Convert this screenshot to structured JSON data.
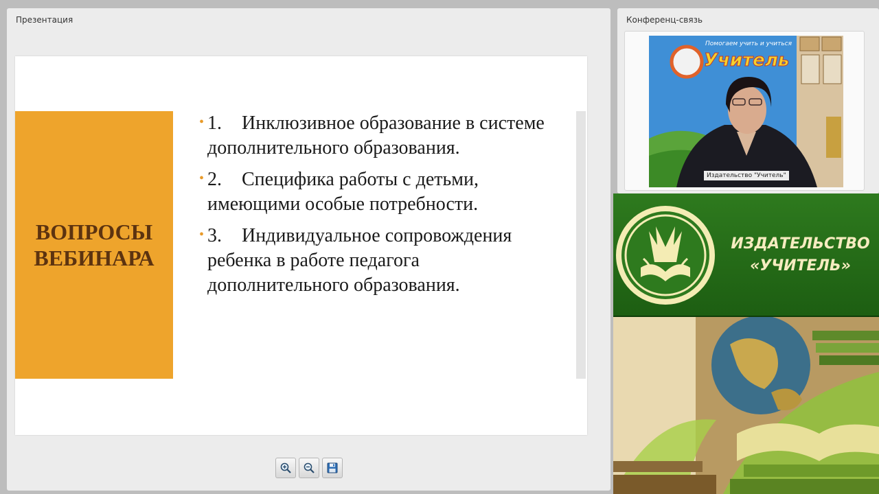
{
  "presentation": {
    "title": "Презентация",
    "slide": {
      "heading": "ВОПРОСЫ ВЕБИНАРА",
      "items": [
        {
          "number": "1.",
          "text": "Инклюзивное образование в системе дополнительного образования."
        },
        {
          "number": "2.",
          "text": "Специфика работы с детьми, имеющими особые потребности."
        },
        {
          "number": "3.",
          "text": "Индивидуальное сопровождения ребенка в работе педагога дополнительного образования."
        }
      ]
    },
    "toolbar": {
      "zoom_in_icon": "zoom-in-icon",
      "zoom_out_icon": "zoom-out-icon",
      "save_icon": "save-icon"
    }
  },
  "conference": {
    "title": "Конференц-связь",
    "video_caption": "Издательство \"Учитель\"",
    "poster_slogan": "Помогаем учить и учиться",
    "poster_brand": "Учитель"
  },
  "banner": {
    "brand_name": "ИЗДАТЕЛЬСТВО «УЧИТЕЛЬ»"
  },
  "colors": {
    "slide_accent": "#eea42c",
    "slide_heading": "#5c3310",
    "banner_green": "#2e7a1e",
    "banner_text": "#f6ecc0"
  }
}
